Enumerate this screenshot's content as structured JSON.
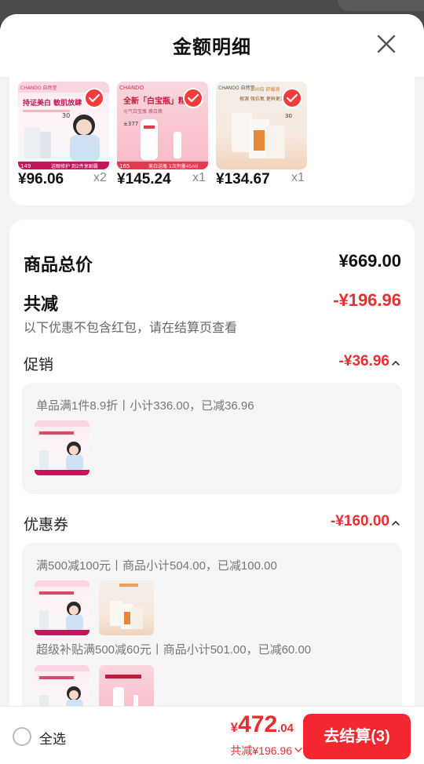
{
  "sheet": {
    "title": "金额明细"
  },
  "products": [
    {
      "price": "¥96.06",
      "qty": "x2",
      "art": "a",
      "brand": "CHANDO 自然堂",
      "headline": "持证美白 敏肌放肆",
      "badge": "149",
      "tag": "送眼修护 到2件享剧霸",
      "days": "30"
    },
    {
      "price": "¥145.24",
      "qty": "x1",
      "art": "b",
      "brand": "CHANDO",
      "headline": "全新「白宝瓶」精",
      "sub": "元气白宝瓶 焕白焕",
      "stat": "±377",
      "badge": "165",
      "tag": "美白送瓶 1次剂量45ml"
    },
    {
      "price": "¥134.67",
      "qty": "x1",
      "art": "c",
      "brand": "CHANDO 自然堂",
      "headline": "100倍 舒缓液",
      "sub": "根源 强抗氧 更鲜更活",
      "days": "30"
    }
  ],
  "summary": {
    "total_label": "商品总价",
    "total_value": "¥669.00",
    "discount_label": "共减",
    "discount_value": "-¥196.96",
    "hint": "以下优惠不包含红包，请在结算页查看",
    "promo_label": "促销",
    "promo_value": "-¥36.96",
    "promo_line": "单品满1件8.9折丨小计336.00，已减36.96",
    "coupon_label": "优惠券",
    "coupon_value": "-¥160.00",
    "coupon_line1": "满500减100元丨商品小计504.00，已减100.00",
    "coupon_line2": "超级补贴满500减60元丨商品小计501.00，已减60.00"
  },
  "footer": {
    "select_all": "全选",
    "currency": "¥",
    "total_int": "472",
    "total_dec": ".04",
    "saved": "共减¥196.96",
    "checkout": "去结算(3)"
  },
  "colors": {
    "accent": "#f2272f",
    "discount_red": "#e63030"
  }
}
